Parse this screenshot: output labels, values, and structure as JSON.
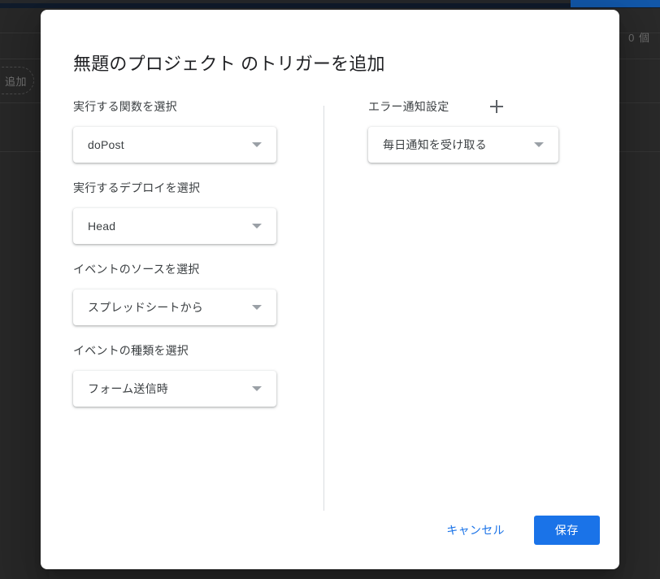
{
  "background": {
    "chip_label": "追加",
    "count_label": "0 個",
    "overlay_color": "#292929"
  },
  "modal": {
    "title": "無題のプロジェクト のトリガーを追加",
    "left_column": [
      {
        "label": "実行する関数を選択",
        "value": "doPost",
        "name": "function-select"
      },
      {
        "label": "実行するデプロイを選択",
        "value": "Head",
        "name": "deployment-select"
      },
      {
        "label": "イベントのソースを選択",
        "value": "スプレッドシートから",
        "name": "event-source-select"
      },
      {
        "label": "イベントの種類を選択",
        "value": "フォーム送信時",
        "name": "event-type-select"
      }
    ],
    "right_column": {
      "label": "エラー通知設定",
      "add_icon": "plus-icon",
      "value": "毎日通知を受け取る"
    },
    "footer": {
      "cancel_label": "キャンセル",
      "save_label": "保存",
      "accent_color": "#1a73e8"
    }
  }
}
